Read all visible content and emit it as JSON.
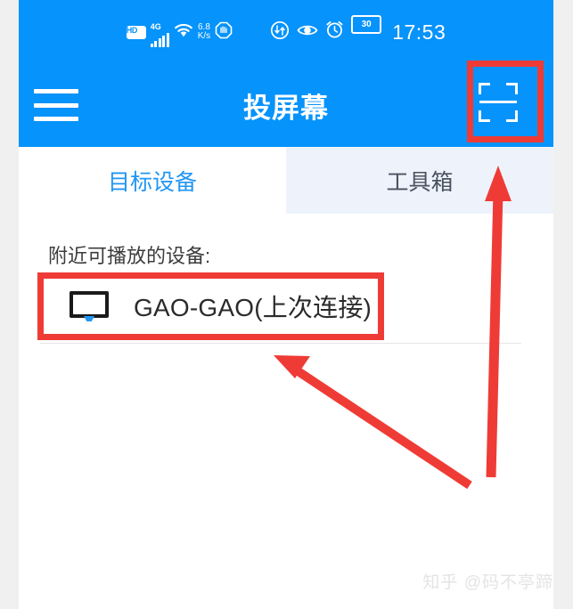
{
  "status_bar": {
    "hd_label": "HD",
    "network_type": "4G",
    "net_speed_value": "6.8",
    "net_speed_unit": "K/s",
    "battery_level": "30",
    "time": "17:53",
    "icons": [
      "hd-badge-icon",
      "signal-bars-icon",
      "wifi-icon",
      "network-speed-icon",
      "do-not-disturb-icon",
      "data-sync-icon",
      "eye-care-icon",
      "alarm-clock-icon",
      "battery-icon"
    ]
  },
  "app_bar": {
    "title": "投屏幕",
    "menu_icon": "hamburger-menu-icon",
    "scan_icon": "qr-scan-icon"
  },
  "tabs": [
    {
      "label": "目标设备",
      "active": true
    },
    {
      "label": "工具箱",
      "active": false
    }
  ],
  "content": {
    "section_label": "附近可播放的设备:",
    "devices": [
      {
        "name": "GAO-GAO(上次连接)",
        "icon": "tv-monitor-icon"
      }
    ]
  },
  "annotations": {
    "highlight_scan": "qr-scan-button",
    "highlight_device": "device-list-item",
    "arrow_to_scan": "arrow-pointing-to-scan-button",
    "arrow_to_device": "arrow-pointing-to-device-item",
    "color": "#ef3b36"
  },
  "watermark": {
    "text": "知乎 @码不亭蹄"
  },
  "colors": {
    "brand_blue": "#0693fb",
    "tab_active": "#2196f3",
    "tab_inactive_bg": "#eef3fb",
    "annotation_red": "#ef3b36"
  }
}
